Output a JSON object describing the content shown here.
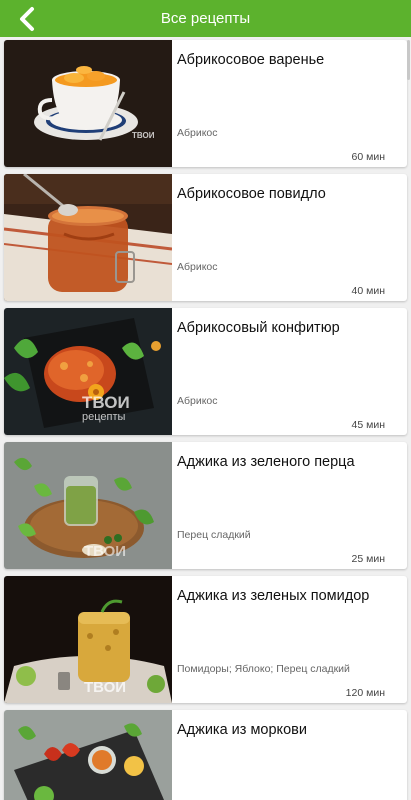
{
  "header": {
    "title": "Все рецепты",
    "back_icon": "chevron-left-icon"
  },
  "watermark": {
    "brand": "ТВОИ",
    "sub": "рецепты"
  },
  "recipes": [
    {
      "title": "Абрикосовое варенье",
      "ingredients": "Абрикос",
      "time": "60 мин"
    },
    {
      "title": "Абрикосовое повидло",
      "ingredients": "Абрикос",
      "time": "40 мин"
    },
    {
      "title": "Абрикосовый конфитюр",
      "ingredients": "Абрикос",
      "time": "45 мин"
    },
    {
      "title": "Аджика из зеленого перца",
      "ingredients": "Перец сладкий",
      "time": "25 мин"
    },
    {
      "title": "Аджика из зеленых помидор",
      "ingredients": "Помидоры; Яблоко; Перец сладкий",
      "time": "120 мин"
    },
    {
      "title": "Аджика из моркови",
      "ingredients": "",
      "time": ""
    }
  ],
  "colors": {
    "header": "#5cb22d",
    "background": "#f0f0f0",
    "card": "#ffffff"
  }
}
